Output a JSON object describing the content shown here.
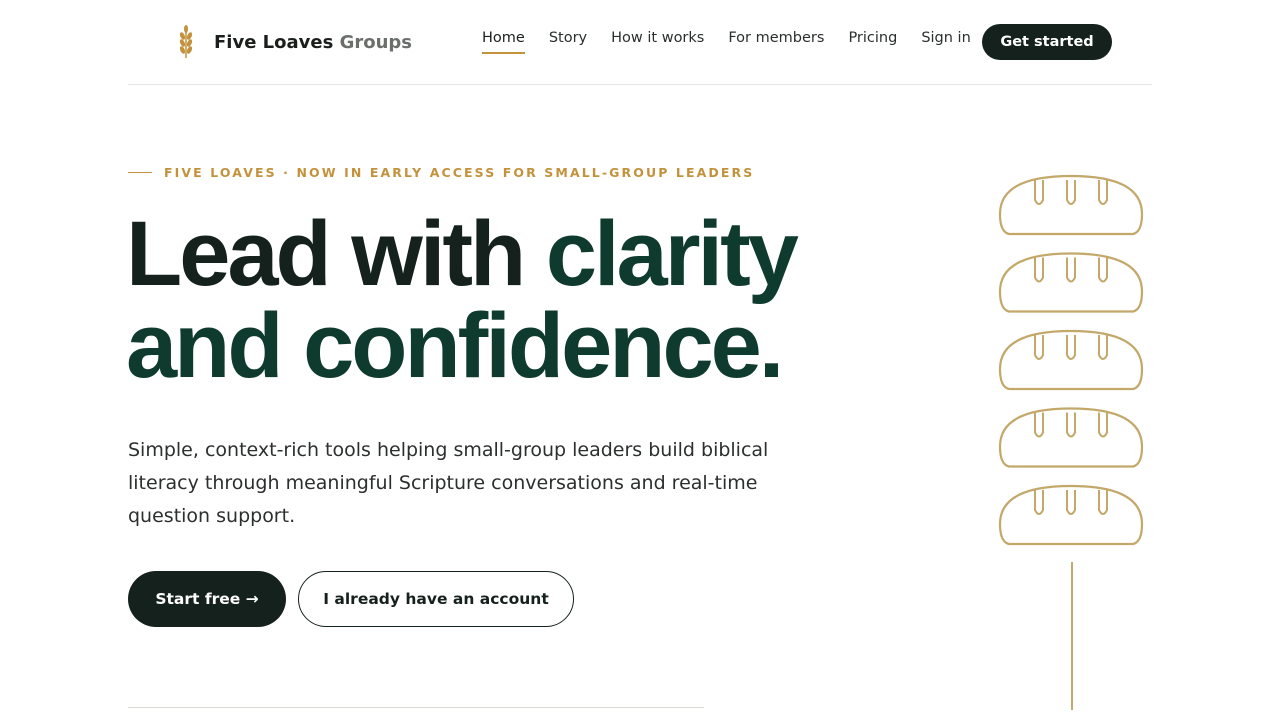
{
  "brand": {
    "name_primary": "Five Loaves",
    "name_secondary": "Groups",
    "icon": "wheat-icon",
    "accent_color": "#c3923c",
    "dark_color": "#15211d",
    "green_color": "#0f3a2e"
  },
  "nav": {
    "items": [
      {
        "label": "Home",
        "active": true
      },
      {
        "label": "Story"
      },
      {
        "label": "How it works"
      },
      {
        "label": "For members"
      },
      {
        "label": "Pricing"
      },
      {
        "label": "Sign in"
      }
    ],
    "cta_label": "Get started"
  },
  "hero": {
    "eyebrow": "FIVE LOAVES · NOW IN EARLY ACCESS FOR SMALL-GROUP LEADERS",
    "headline_part1": "Lead with ",
    "headline_part2": "clarity",
    "headline_line2": "and confidence.",
    "lede": "Simple, context-rich tools helping small-group leaders build biblical literacy through meaningful Scripture conversations and real-time question support.",
    "primary_button": "Start free →",
    "secondary_button": "I already have an account"
  },
  "illustration": {
    "icon": "bread-loaf-icon",
    "loaf_count": 5
  }
}
